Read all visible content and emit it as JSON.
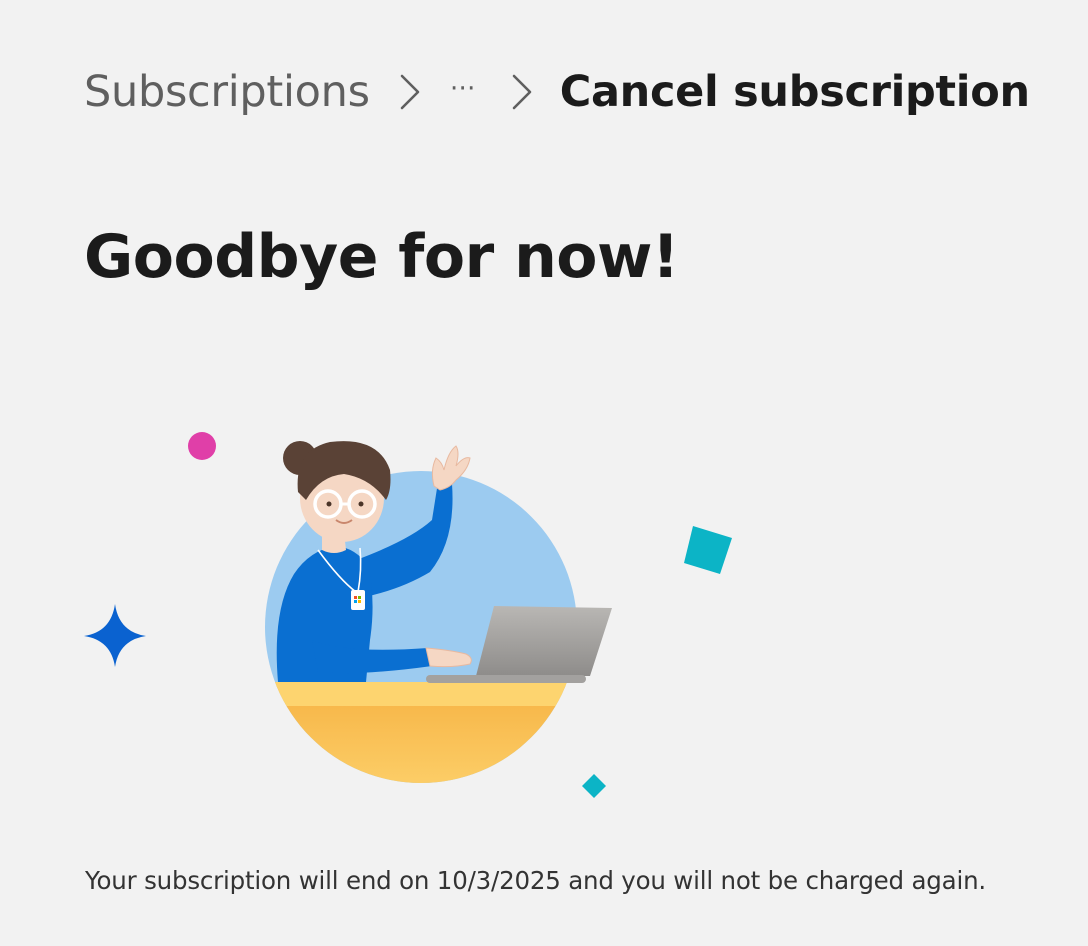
{
  "breadcrumb": {
    "root_label": "Subscriptions",
    "overflow_label": "⋯",
    "current_label": "Cancel subscription"
  },
  "main": {
    "heading": "Goodbye for now!",
    "notice": "Your subscription will end on 10/3/2025 and you will not be charged again."
  },
  "illustration": {
    "subject": "person-waving-at-laptop",
    "colors": {
      "circle": "#9ccbf0",
      "shirt": "#0a6fd1",
      "desk": "#f6bd4d",
      "laptop": "#a8a6a3",
      "hair": "#5a4236",
      "sparkle_blue": "#0a62d0",
      "dot_pink": "#e03fa8",
      "diamond_teal": "#0cb4c6"
    }
  }
}
